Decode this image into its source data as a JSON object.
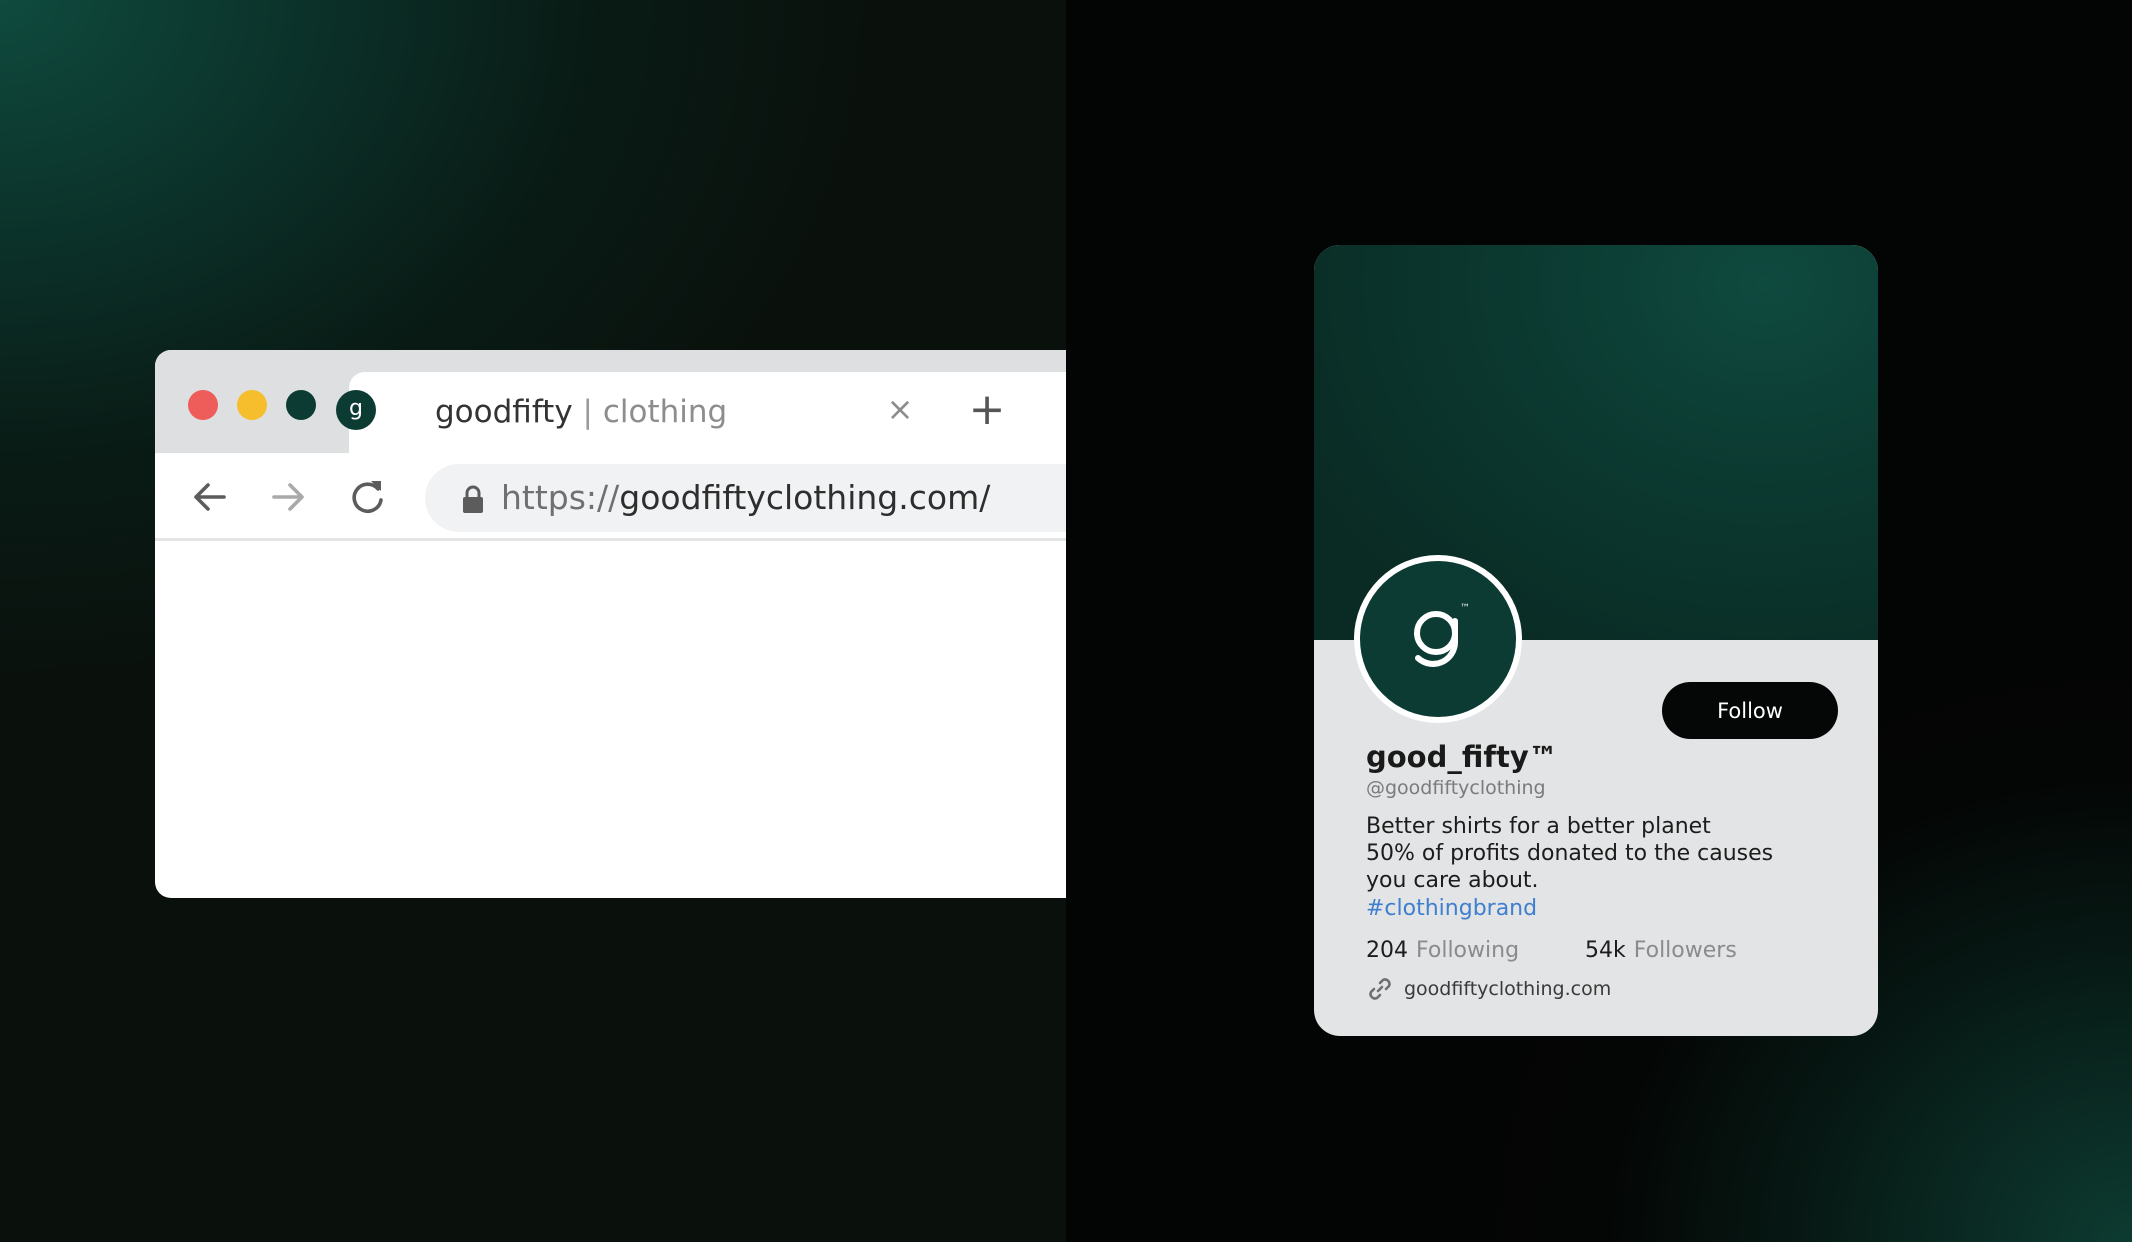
{
  "colors": {
    "traffic_red": "#ef5d5a",
    "traffic_yellow": "#f6bd2c",
    "traffic_green": "#0c3b33",
    "brand_dark_green": "#0c3b33",
    "hashtag_blue": "#3f7fcf",
    "follow_button": "#050606"
  },
  "browser": {
    "tab": {
      "favicon_letter": "g",
      "title_brand": "goodfifty",
      "title_separator": " | ",
      "title_suffix": "clothing",
      "close_glyph": "×"
    },
    "new_tab_glyph": "+",
    "toolbar": {
      "back_icon": "arrow-left-icon",
      "forward_icon": "arrow-right-icon",
      "reload_icon": "reload-icon"
    },
    "address_bar": {
      "lock_icon": "lock-icon",
      "url_scheme": "https://",
      "url_host": "goodfiftyclothing.com/"
    }
  },
  "profile": {
    "avatar_letter": "g",
    "avatar_mark": "™",
    "follow_label": "Follow",
    "display_name": "good_fifty™",
    "handle": "@goodfiftyclothing",
    "bio_lines": [
      "Better shirts for a better planet",
      "50% of profits donated to the causes",
      "you care about."
    ],
    "hashtag": "#clothingbrand",
    "following_count": "204",
    "following_label": "Following",
    "followers_count": "54k",
    "followers_label": "Followers",
    "link_icon": "link-icon",
    "website": "goodfiftyclothing.com"
  }
}
